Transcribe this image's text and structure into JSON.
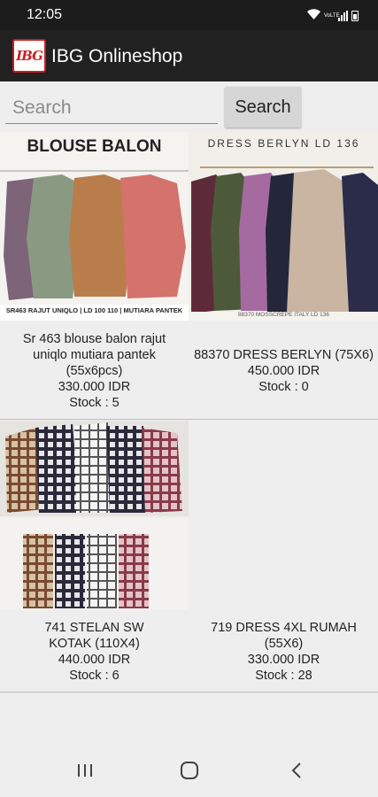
{
  "status_bar": {
    "time": "12:05",
    "network_label": "VoLTE"
  },
  "app": {
    "title": "IBG Onlineshop",
    "logo_text": "IBG"
  },
  "search": {
    "placeholder": "Search",
    "button_label": "Search"
  },
  "products": [
    {
      "image_caption": "BLOUSE BALON",
      "image_footer": "SR463 RAJUT UNIQLO | LD 100 110 | MUTIARA PANTEK",
      "name": "Sr 463 blouse balon rajut uniqlo mutiara pantek (55x6pcs)",
      "price": "330.000 IDR",
      "stock": "Stock : 5"
    },
    {
      "image_caption": "DRESS BERLYN LD 136",
      "image_footer": "88370 MOSSCREPE ITALY LD 136",
      "name": "88370 DRESS BERLYN (75X6)",
      "price": "450.000 IDR",
      "stock": "Stock : 0"
    },
    {
      "name": "741 STELAN SW KOTAK (110X4)",
      "price": "440.000 IDR",
      "stock": "Stock : 6"
    },
    {
      "name": "719 DRESS 4XL RUMAH (55X6)",
      "price": "330.000 IDR",
      "stock": "Stock : 28"
    }
  ],
  "colors": {
    "app_bar": "#212121",
    "status_bar": "#1c1c1c",
    "background": "#eeeeee",
    "search_button": "#d6d6d6"
  },
  "nav_icons": [
    "recent-apps-icon",
    "home-icon",
    "back-icon"
  ]
}
